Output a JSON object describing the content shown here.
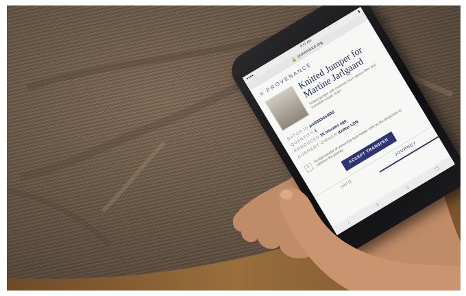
{
  "colors": {
    "knit": "#7a6653",
    "table": "#8a6236",
    "skin": "#c9946f",
    "brand_navy": "#2f3574"
  },
  "phone": {
    "status": {
      "carrier": "●●●●",
      "time": "9:41 AM",
      "battery": "▮"
    },
    "url": "provenance.org",
    "brand": "PROVENANCE",
    "product": {
      "title": "Knitted Jumper for Martine Jarlgaard",
      "description": "Knitted jumper with materials from alpaca fibre and traceable supply chain"
    },
    "meta": [
      {
        "key": "BATCH ID",
        "value": "pm9389dsd8fd"
      },
      {
        "key": "QUANTITY",
        "value": "1"
      },
      {
        "key": "PRODUCED",
        "value": "26 minutes ago"
      },
      {
        "key": "CURRENT OWNER",
        "value": "Knitter LDN"
      }
    ],
    "notice": {
      "chip": "?",
      "text": "Accept transfer of ownership from Knitter LDN on the blockchain to continue the journey"
    },
    "accept_label": "ACCEPT TRANSFER",
    "tabs": [
      "INFO",
      "JOURNEY"
    ],
    "active_tab": 1,
    "bottom_icons": [
      "back-icon",
      "share-icon",
      "book-icon",
      "tabs-icon"
    ]
  }
}
